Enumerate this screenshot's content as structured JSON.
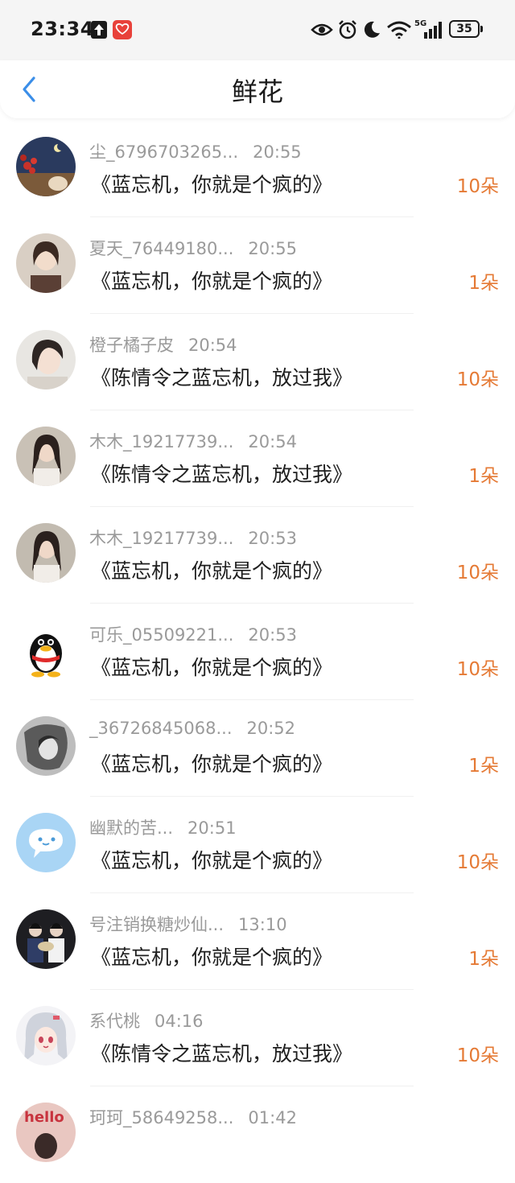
{
  "status_bar": {
    "time": "23:34",
    "battery": "35",
    "network": "5G"
  },
  "header": {
    "title": "鲜花"
  },
  "rows": [
    {
      "name": "尘_6796703265...",
      "time": "20:55",
      "message": "《蓝忘机，你就是个疯的》",
      "count": "10朵",
      "avatar": "night-sky-flowers"
    },
    {
      "name": "夏天_76449180...",
      "time": "20:55",
      "message": "《蓝忘机，你就是个疯的》",
      "count": "1朵",
      "avatar": "girl-portrait"
    },
    {
      "name": "橙子橘子皮",
      "time": "20:54",
      "message": "《陈情令之蓝忘机，放过我》",
      "count": "10朵",
      "avatar": "girl-portrait"
    },
    {
      "name": "木木_19217739...",
      "time": "20:54",
      "message": "《陈情令之蓝忘机，放过我》",
      "count": "1朵",
      "avatar": "girl-portrait"
    },
    {
      "name": "木木_19217739...",
      "time": "20:53",
      "message": "《蓝忘机，你就是个疯的》",
      "count": "10朵",
      "avatar": "girl-portrait"
    },
    {
      "name": "可乐_05509221...",
      "time": "20:53",
      "message": "《蓝忘机，你就是个疯的》",
      "count": "10朵",
      "avatar": "qq-penguin"
    },
    {
      "name": "_36726845068...",
      "time": "20:52",
      "message": "《蓝忘机，你就是个疯的》",
      "count": "1朵",
      "avatar": "mono-portrait"
    },
    {
      "name": "幽默的苦...",
      "time": "20:51",
      "message": "《蓝忘机，你就是个疯的》",
      "count": "10朵",
      "avatar": "chat-bubble"
    },
    {
      "name": "号注销换糖炒仙...",
      "time": "13:10",
      "message": "《蓝忘机，你就是个疯的》",
      "count": "1朵",
      "avatar": "two-people"
    },
    {
      "name": "系代桃",
      "time": "04:16",
      "message": "《陈情令之蓝忘机，放过我》",
      "count": "10朵",
      "avatar": "anime-girl"
    },
    {
      "name": "珂珂_58649258...",
      "time": "01:42",
      "message": "",
      "count": "",
      "avatar": "hello-image"
    }
  ],
  "colors": {
    "accent": "#3b8ee8",
    "count": "#e57a35"
  }
}
